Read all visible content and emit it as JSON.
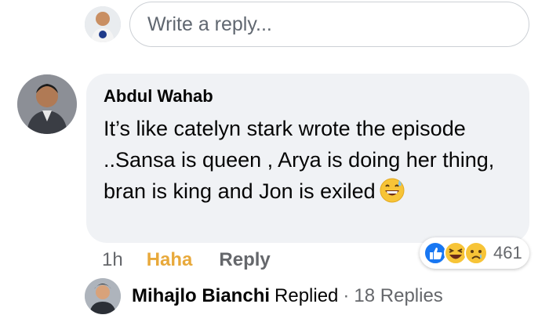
{
  "reply_composer": {
    "placeholder": "Write a reply..."
  },
  "comment": {
    "author": "Abdul Wahab",
    "text": "It’s like catelyn stark wrote the episode ..Sansa is queen , Arya is doing her thing, bran is king and Jon is exiled",
    "inline_emoji": "grinning-sweat-emoji",
    "time": "1h",
    "reaction_label": "Haha",
    "reply_label": "Reply",
    "reactions": {
      "icons": [
        "like-icon",
        "haha-icon",
        "sad-icon"
      ],
      "count": "461"
    }
  },
  "replies_summary": {
    "name": "Mihajlo Bianchi",
    "verb": "Replied",
    "separator": "·",
    "count_text": "18 Replies"
  },
  "colors": {
    "haha": "#e8a93b",
    "bubble": "#f0f2f5",
    "like_blue": "#1877f2",
    "secondary_text": "#65676b"
  }
}
